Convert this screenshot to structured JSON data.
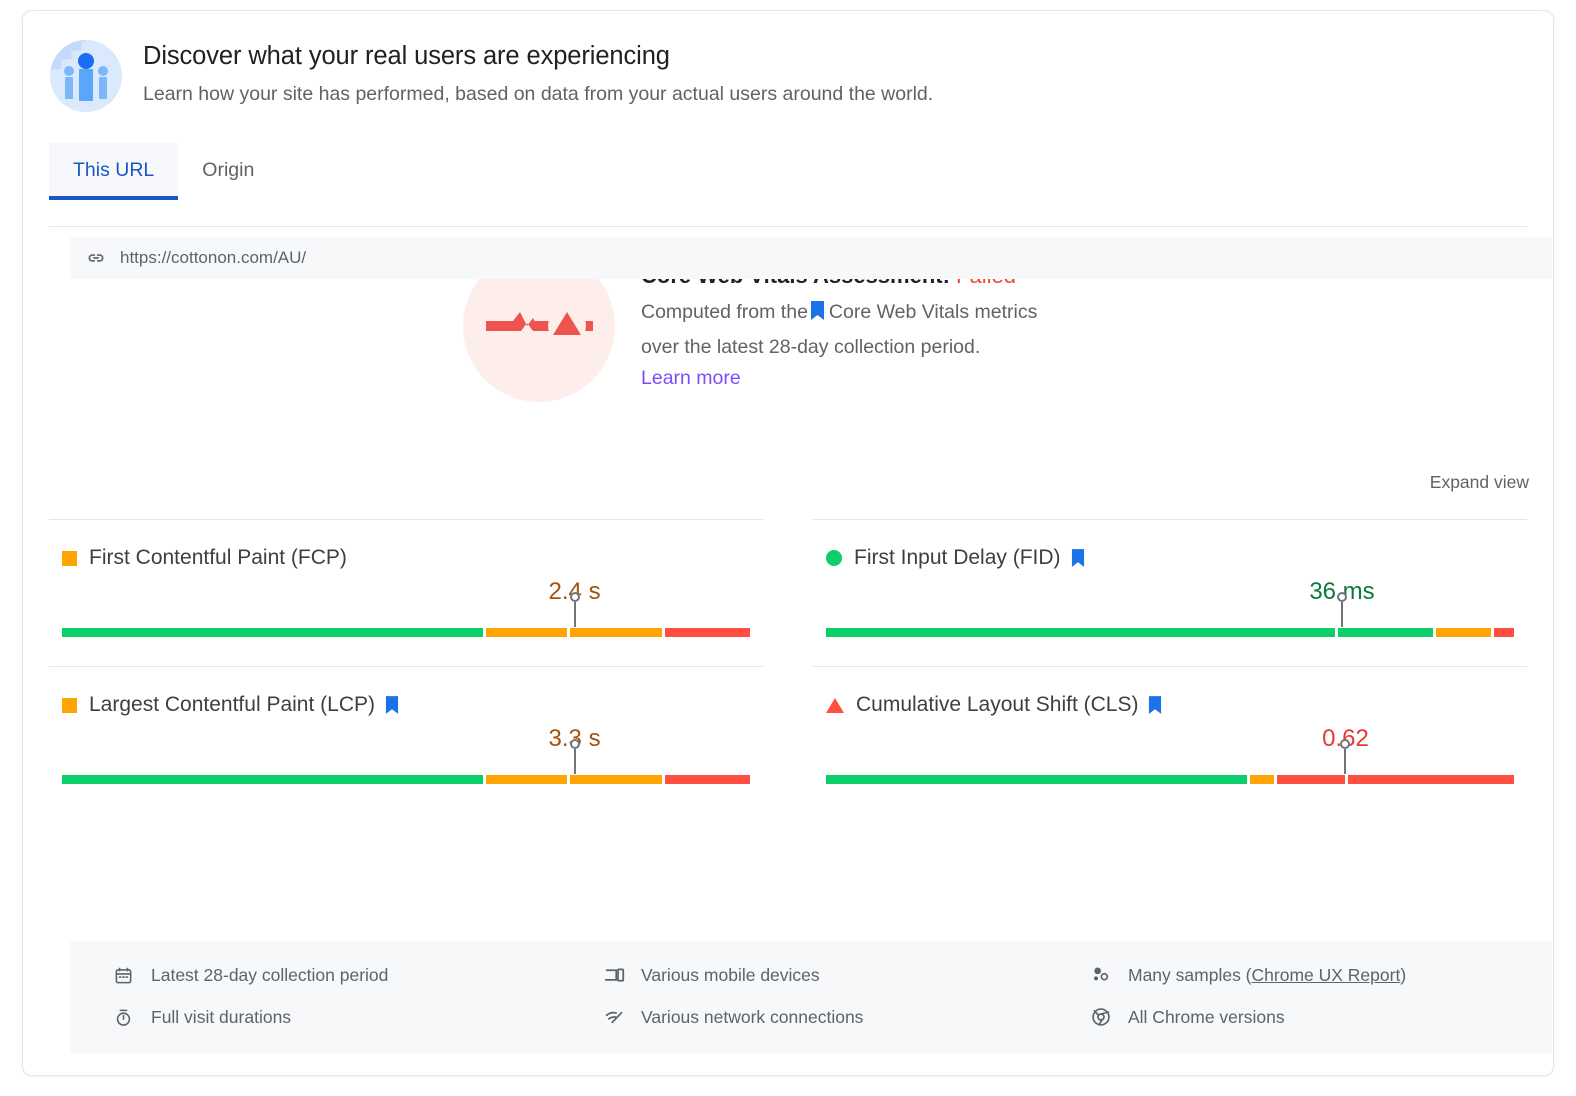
{
  "header": {
    "icon": "globe-users-icon",
    "title": "Discover what your real users are experiencing",
    "subtitle": "Learn how your site has performed, based on data from your actual users around the world."
  },
  "tabs": [
    {
      "label": "This URL",
      "active": true
    },
    {
      "label": "Origin",
      "active": false
    }
  ],
  "url_bar": {
    "icon": "link-icon",
    "url": "https://cottonon.com/AU/"
  },
  "assessment": {
    "icon": "failed-pulse-icon",
    "title_prefix": "Core Web Vitals Assessment: ",
    "status": "Failed",
    "status_color": "#f44336",
    "description_line1_a": "Computed from the",
    "description_line1_b": "Core Web Vitals metrics",
    "description_line2": "over the latest 28-day collection period.",
    "learn_more": "Learn more",
    "learn_more_color": "#7c4dff"
  },
  "expand_view": "Expand view",
  "metrics": [
    {
      "name": "First Contentful Paint (FCP)",
      "icon": "orange-square-icon",
      "status": "average",
      "value": "2.4 s",
      "value_color": "#a3540a",
      "core_web_vital": false,
      "marker_pct": 74.5,
      "segments": [
        {
          "color": "#0cce6b",
          "pct": 62.0
        },
        {
          "color": "#ffa400",
          "pct": 12.0
        },
        {
          "color": "#ffa400",
          "pct": 13.5
        },
        {
          "color": "#ff4e42",
          "pct": 12.5
        }
      ]
    },
    {
      "name": "First Input Delay (FID)",
      "icon": "green-circle-icon",
      "status": "good",
      "value": "36 ms",
      "value_color": "#0a7a3d",
      "core_web_vital": true,
      "marker_pct": 75.0,
      "segments": [
        {
          "color": "#0cce6b",
          "pct": 75.0
        },
        {
          "color": "#0cce6b",
          "pct": 14.0
        },
        {
          "color": "#ffa400",
          "pct": 8.0
        },
        {
          "color": "#ff4e42",
          "pct": 3.0
        }
      ]
    },
    {
      "name": "Largest Contentful Paint (LCP)",
      "icon": "orange-square-icon",
      "status": "average",
      "value": "3.3 s",
      "value_color": "#a3540a",
      "core_web_vital": true,
      "marker_pct": 74.5,
      "segments": [
        {
          "color": "#0cce6b",
          "pct": 62.0
        },
        {
          "color": "#ffa400",
          "pct": 12.0
        },
        {
          "color": "#ffa400",
          "pct": 13.5
        },
        {
          "color": "#ff4e42",
          "pct": 12.5
        }
      ]
    },
    {
      "name": "Cumulative Layout Shift (CLS)",
      "icon": "red-triangle-icon",
      "status": "poor",
      "value": "0.62",
      "value_color": "#e53935",
      "core_web_vital": true,
      "marker_pct": 75.5,
      "segments": [
        {
          "color": "#0cce6b",
          "pct": 62.0
        },
        {
          "color": "#ffa400",
          "pct": 3.5
        },
        {
          "color": "#ff4e42",
          "pct": 10.0
        },
        {
          "color": "#ff4e42",
          "pct": 24.5
        }
      ]
    }
  ],
  "footer": [
    {
      "icon": "calendar-icon",
      "label": "Latest 28-day collection period"
    },
    {
      "icon": "devices-icon",
      "label": "Various mobile devices"
    },
    {
      "icon": "samples-icon",
      "label_prefix": "Many samples (",
      "link": "Chrome UX Report",
      "label_suffix": ")"
    },
    {
      "icon": "stopwatch-icon",
      "label": "Full visit durations"
    },
    {
      "icon": "network-icon",
      "label": "Various network connections"
    },
    {
      "icon": "chrome-icon",
      "label": "All Chrome versions"
    }
  ],
  "colors": {
    "good": "#0cce6b",
    "average": "#ffa400",
    "poor": "#ff4e42",
    "accent": "#1a56c4",
    "bookmark": "#1a73e8"
  }
}
